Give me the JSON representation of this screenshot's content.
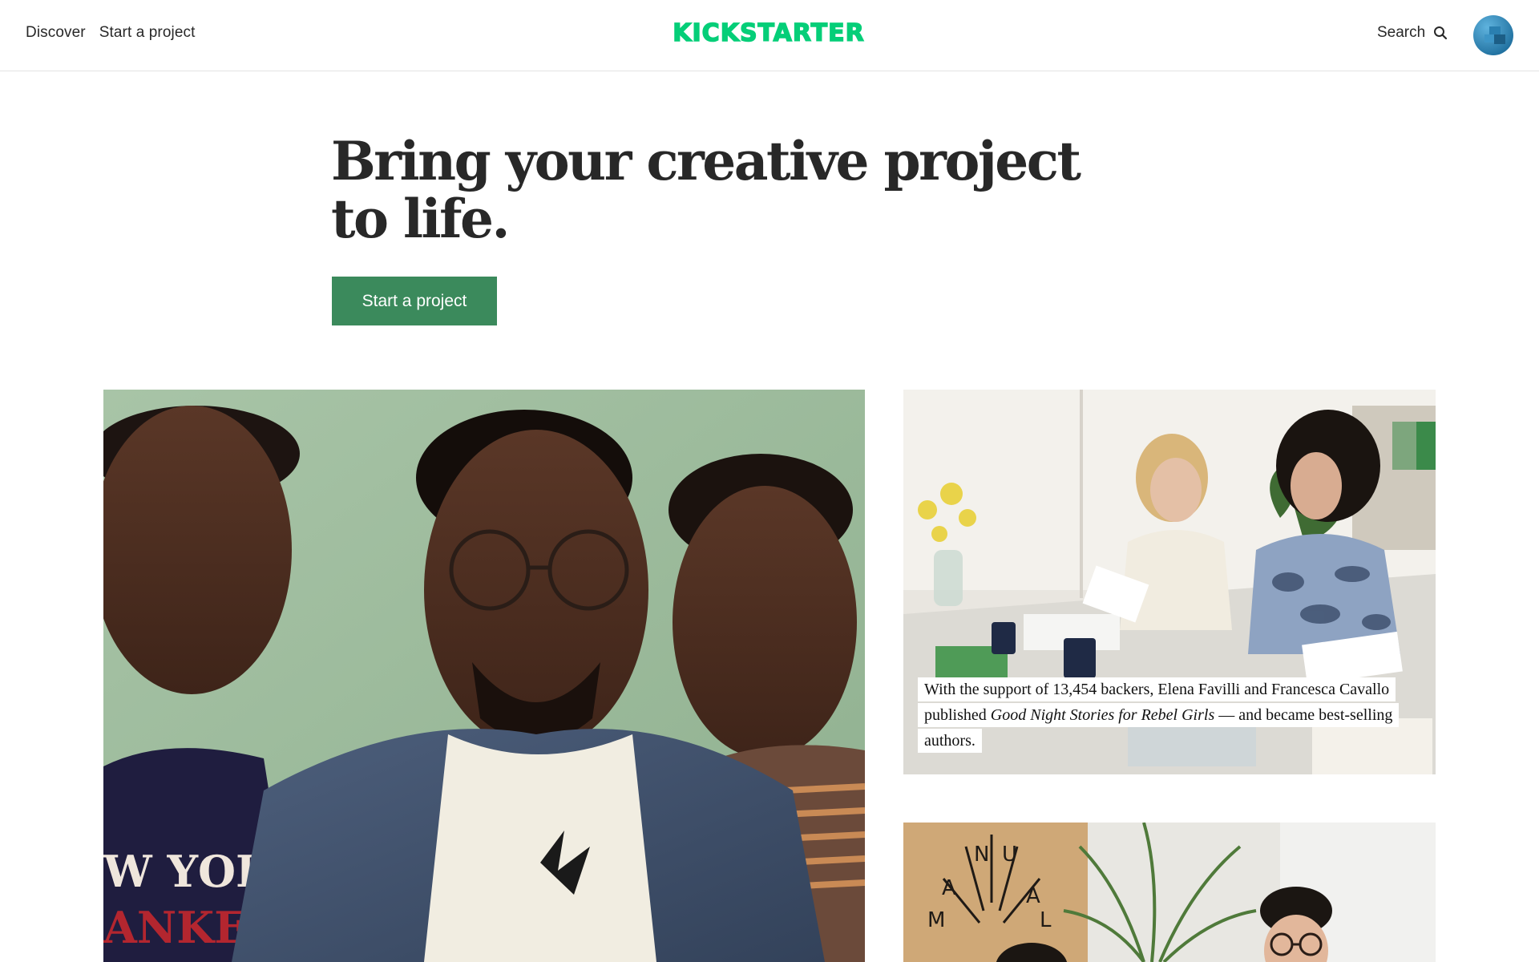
{
  "header": {
    "nav_left": [
      {
        "label": "Discover"
      },
      {
        "label": "Start a project"
      }
    ],
    "logo_text": "KICKSTARTER",
    "search_label": "Search",
    "colors": {
      "brand": "#05ce78",
      "border": "#e3e3e3"
    }
  },
  "hero": {
    "title_line1": "Bring your creative project",
    "title_line2": "to life.",
    "cta_label": "Start a project",
    "cta_color": "#3b8a5c"
  },
  "featured": {
    "story_caption": {
      "prefix": "With the support of 13,454 backers, Elena Favilli and Francesca Cavallo published ",
      "title": "Good Night Stories for Rebel Girls",
      "suffix": " — and became best-selling authors."
    },
    "sign_letters": [
      "N",
      "U",
      "A",
      "A",
      "M",
      "L"
    ]
  },
  "icons": {
    "search": "search-icon",
    "avatar": "avatar-icon"
  }
}
